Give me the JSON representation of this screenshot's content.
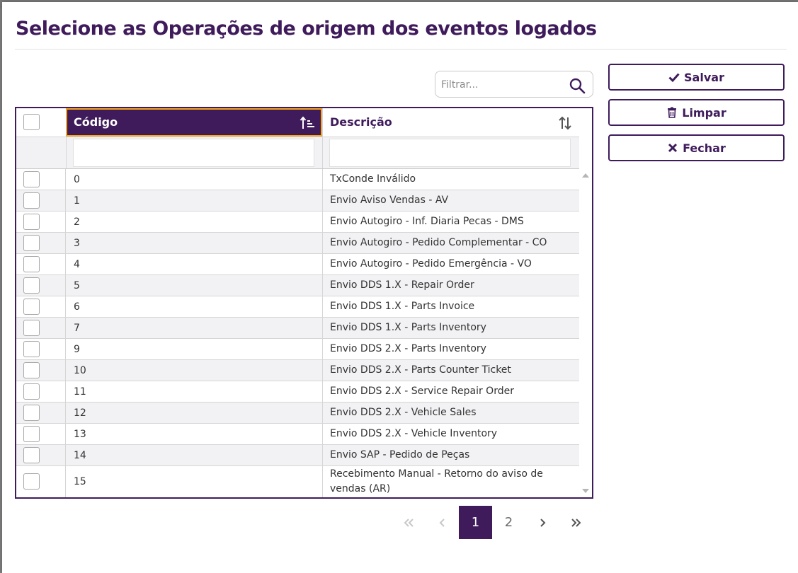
{
  "dialog": {
    "title": "Selecione as Operações de origem dos eventos logados"
  },
  "filter": {
    "placeholder": "Filtrar...",
    "value": ""
  },
  "buttons": {
    "save": "Salvar",
    "clear": "Limpar",
    "close": "Fechar"
  },
  "grid": {
    "columns": {
      "code": "Código",
      "description": "Descrição"
    },
    "sort": {
      "code": "ascending",
      "description": "none"
    },
    "rows": [
      {
        "code": "0",
        "description": "TxConde Inválido"
      },
      {
        "code": "1",
        "description": "Envio Aviso Vendas - AV"
      },
      {
        "code": "2",
        "description": "Envio Autogiro - Inf. Diaria Pecas - DMS"
      },
      {
        "code": "3",
        "description": "Envio Autogiro - Pedido Complementar - CO"
      },
      {
        "code": "4",
        "description": "Envio Autogiro - Pedido Emergência - VO"
      },
      {
        "code": "5",
        "description": "Envio DDS 1.X - Repair Order"
      },
      {
        "code": "6",
        "description": "Envio DDS 1.X - Parts Invoice"
      },
      {
        "code": "7",
        "description": "Envio DDS 1.X - Parts Inventory"
      },
      {
        "code": "9",
        "description": "Envio DDS 2.X - Parts Inventory"
      },
      {
        "code": "10",
        "description": "Envio DDS 2.X - Parts Counter Ticket"
      },
      {
        "code": "11",
        "description": "Envio DDS 2.X - Service Repair Order"
      },
      {
        "code": "12",
        "description": "Envio DDS 2.X - Vehicle Sales"
      },
      {
        "code": "13",
        "description": "Envio DDS 2.X - Vehicle Inventory"
      },
      {
        "code": "14",
        "description": "Envio SAP - Pedido de Peças"
      },
      {
        "code": "15",
        "description": "Recebimento Manual - Retorno do aviso de vendas (AR)"
      }
    ]
  },
  "pagination": {
    "pages": [
      "1",
      "2"
    ],
    "current": "1"
  },
  "colors": {
    "primary": "#3f1b5b",
    "header_focus_border": "#f5a623",
    "row_alt": "#f2f2f4"
  }
}
